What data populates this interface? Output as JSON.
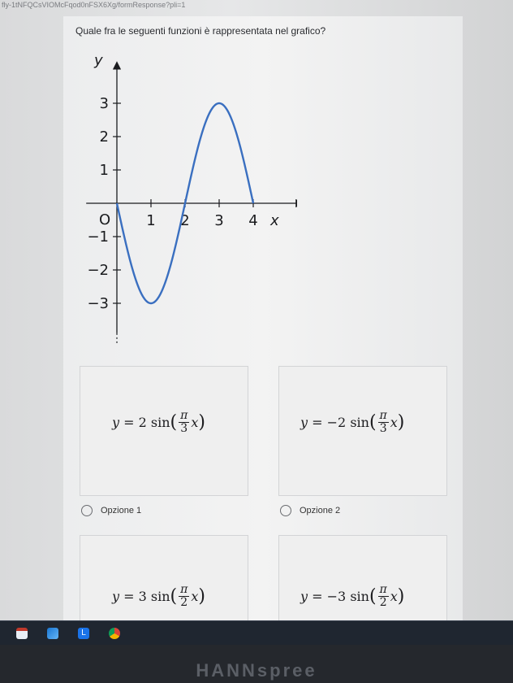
{
  "browser": {
    "url": "fly-1tNFQCsVIOMcFqod0nFSX6Xg/formResponse?pli=1"
  },
  "form": {
    "question": "Quale fra le seguenti funzioni è rappresentata nel grafico?",
    "options": [
      {
        "label": "Opzione 1",
        "formula": {
          "lhs": "y",
          "coef": "2",
          "fn": "sin",
          "num": "π",
          "den": "3",
          "var": "x"
        }
      },
      {
        "label": "Opzione 2",
        "formula": {
          "lhs": "y",
          "coef": "−2",
          "fn": "sin",
          "num": "π",
          "den": "3",
          "var": "x"
        }
      },
      {
        "label": "",
        "formula": {
          "lhs": "y",
          "coef": "3",
          "fn": "sin",
          "num": "π",
          "den": "2",
          "var": "x"
        }
      },
      {
        "label": "",
        "formula": {
          "lhs": "y",
          "coef": "−3",
          "fn": "sin",
          "num": "π",
          "den": "2",
          "var": "x"
        }
      }
    ]
  },
  "chart_data": {
    "type": "line",
    "xlabel": "x",
    "ylabel": "y",
    "origin_label": "O",
    "xticks": [
      "1",
      "2",
      "3",
      "4"
    ],
    "yticks": [
      "3",
      "2",
      "1",
      "−1",
      "−2",
      "−3"
    ],
    "xlim": [
      -0.9,
      5.0
    ],
    "ylim": [
      -3.9,
      4.2
    ],
    "series": [
      {
        "function": "y = -3 sin(πx/2)",
        "x_range": [
          0,
          4
        ],
        "color": "#3a6fc0"
      }
    ]
  },
  "taskbar": {
    "icons": [
      "calendar-icon",
      "outlook-icon",
      "lens-icon",
      "chrome-icon"
    ]
  },
  "monitor": {
    "brand": "HANNspree"
  }
}
